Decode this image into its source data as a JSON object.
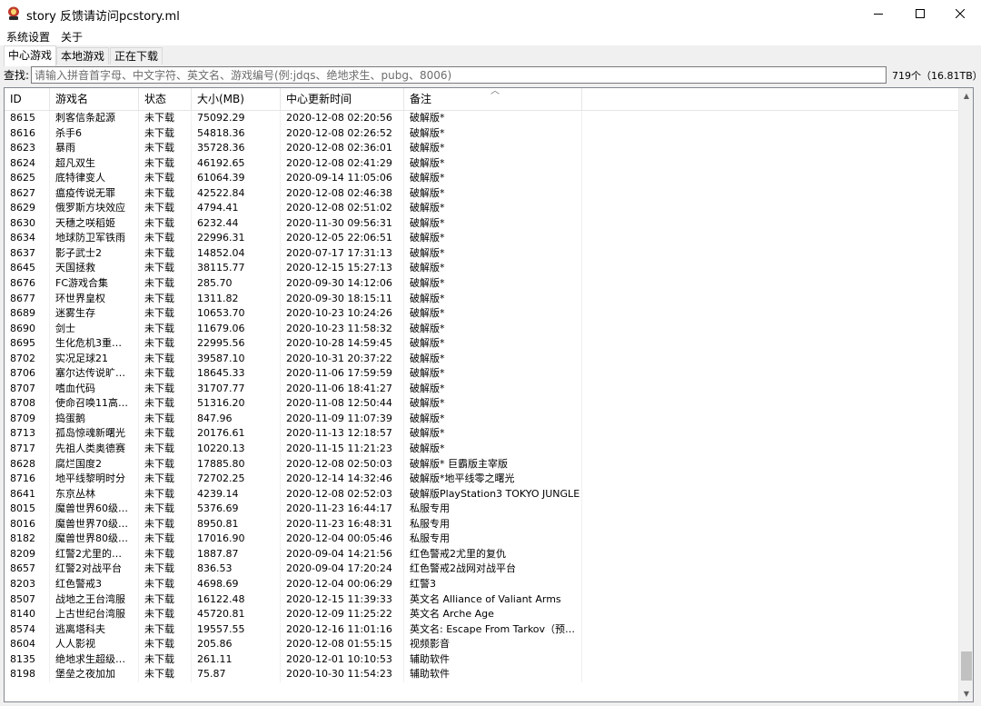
{
  "window": {
    "title": "story 反馈请访问pcstory.ml"
  },
  "menu": [
    "系统设置",
    "关于"
  ],
  "tabs": [
    "中心游戏",
    "本地游戏",
    "正在下载"
  ],
  "search": {
    "label": "查找:",
    "placeholder": "请输入拼音首字母、中文字符、英文名、游戏编号(例:jdqs、绝地求生、pubg、8006)",
    "count": "719个（16.81TB）"
  },
  "columns": [
    "ID",
    "游戏名",
    "状态",
    "大小(MB)",
    "中心更新时间",
    "备注"
  ],
  "rows": [
    [
      "8615",
      "刺客信条起源",
      "未下载",
      "75092.29",
      "2020-12-08 02:20:56",
      "破解版*"
    ],
    [
      "8616",
      "杀手6",
      "未下载",
      "54818.36",
      "2020-12-08 02:26:52",
      "破解版*"
    ],
    [
      "8623",
      "暴雨",
      "未下载",
      "35728.36",
      "2020-12-08 02:36:01",
      "破解版*"
    ],
    [
      "8624",
      "超凡双生",
      "未下载",
      "46192.65",
      "2020-12-08 02:41:29",
      "破解版*"
    ],
    [
      "8625",
      "底特律变人",
      "未下载",
      "61064.39",
      "2020-09-14 11:05:06",
      "破解版*"
    ],
    [
      "8627",
      "瘟疫传说无罪",
      "未下载",
      "42522.84",
      "2020-12-08 02:46:38",
      "破解版*"
    ],
    [
      "8629",
      "俄罗斯方块效应",
      "未下载",
      "4794.41",
      "2020-12-08 02:51:02",
      "破解版*"
    ],
    [
      "8630",
      "天穗之咲稻姬",
      "未下载",
      "6232.44",
      "2020-11-30 09:56:31",
      "破解版*"
    ],
    [
      "8634",
      "地球防卫军铁雨",
      "未下载",
      "22996.31",
      "2020-12-05 22:06:51",
      "破解版*"
    ],
    [
      "8637",
      "影子武士2",
      "未下载",
      "14852.04",
      "2020-07-17 17:31:13",
      "破解版*"
    ],
    [
      "8645",
      "天国拯救",
      "未下载",
      "38115.77",
      "2020-12-15 15:27:13",
      "破解版*"
    ],
    [
      "8676",
      "FC游戏合集",
      "未下载",
      "285.70",
      "2020-09-30 14:12:06",
      "破解版*"
    ],
    [
      "8677",
      "环世界皇权",
      "未下载",
      "1311.82",
      "2020-09-30 18:15:11",
      "破解版*"
    ],
    [
      "8689",
      "迷雾生存",
      "未下载",
      "10653.70",
      "2020-10-23 10:24:26",
      "破解版*"
    ],
    [
      "8690",
      "剑士",
      "未下载",
      "11679.06",
      "2020-10-23 11:58:32",
      "破解版*"
    ],
    [
      "8695",
      "生化危机3重…",
      "未下载",
      "22995.56",
      "2020-10-28 14:59:45",
      "破解版*"
    ],
    [
      "8702",
      "实况足球21",
      "未下载",
      "39587.10",
      "2020-10-31 20:37:22",
      "破解版*"
    ],
    [
      "8706",
      "塞尔达传说旷…",
      "未下载",
      "18645.33",
      "2020-11-06 17:59:59",
      "破解版*"
    ],
    [
      "8707",
      "嗜血代码",
      "未下载",
      "31707.77",
      "2020-11-06 18:41:27",
      "破解版*"
    ],
    [
      "8708",
      "使命召唤11高…",
      "未下载",
      "51316.20",
      "2020-11-08 12:50:44",
      "破解版*"
    ],
    [
      "8709",
      "捣蛋鹅",
      "未下载",
      "847.96",
      "2020-11-09 11:07:39",
      "破解版*"
    ],
    [
      "8713",
      "孤岛惊魂新曙光",
      "未下载",
      "20176.61",
      "2020-11-13 12:18:57",
      "破解版*"
    ],
    [
      "8717",
      "先祖人类奥德赛",
      "未下载",
      "10220.13",
      "2020-11-15 11:21:23",
      "破解版*"
    ],
    [
      "8628",
      "腐烂国度2",
      "未下载",
      "17885.80",
      "2020-12-08 02:50:03",
      "破解版* 巨霸版主宰版"
    ],
    [
      "8716",
      "地平线黎明时分",
      "未下载",
      "72702.25",
      "2020-12-14 14:32:46",
      "破解版*地平线零之曙光"
    ],
    [
      "8641",
      "东京丛林",
      "未下载",
      "4239.14",
      "2020-12-08 02:52:03",
      "破解版PlayStation3 TOKYO JUNGLE"
    ],
    [
      "8015",
      "魔兽世界60级…",
      "未下载",
      "5376.69",
      "2020-11-23 16:44:17",
      "私服专用"
    ],
    [
      "8016",
      "魔兽世界70级…",
      "未下载",
      "8950.81",
      "2020-11-23 16:48:31",
      "私服专用"
    ],
    [
      "8182",
      "魔兽世界80级…",
      "未下载",
      "17016.90",
      "2020-12-04 00:05:46",
      "私服专用"
    ],
    [
      "8209",
      "红警2尤里的…",
      "未下载",
      "1887.87",
      "2020-09-04 14:21:56",
      "红色警戒2尤里的复仇"
    ],
    [
      "8657",
      "红警2对战平台",
      "未下载",
      "836.53",
      "2020-09-04 17:20:24",
      "红色警戒2战网对战平台"
    ],
    [
      "8203",
      "红色警戒3",
      "未下载",
      "4698.69",
      "2020-12-04 00:06:29",
      "红警3"
    ],
    [
      "8507",
      "战地之王台湾服",
      "未下载",
      "16122.48",
      "2020-12-15 11:39:33",
      "英文名 Alliance of Valiant Arms"
    ],
    [
      "8140",
      "上古世纪台湾服",
      "未下载",
      "45720.81",
      "2020-12-09 11:25:22",
      "英文名 Arche Age"
    ],
    [
      "8574",
      "逃离塔科夫",
      "未下载",
      "19557.55",
      "2020-12-16 11:01:16",
      "英文名: Escape From Tarkov（预…"
    ],
    [
      "8604",
      "人人影视",
      "未下载",
      "205.86",
      "2020-12-08 01:55:15",
      "视频影音"
    ],
    [
      "8135",
      "绝地求生超级…",
      "未下载",
      "261.11",
      "2020-12-01 10:10:53",
      "辅助软件"
    ],
    [
      "8198",
      "堡垒之夜加加",
      "未下载",
      "75.87",
      "2020-10-30 11:54:23",
      "辅助软件"
    ]
  ]
}
